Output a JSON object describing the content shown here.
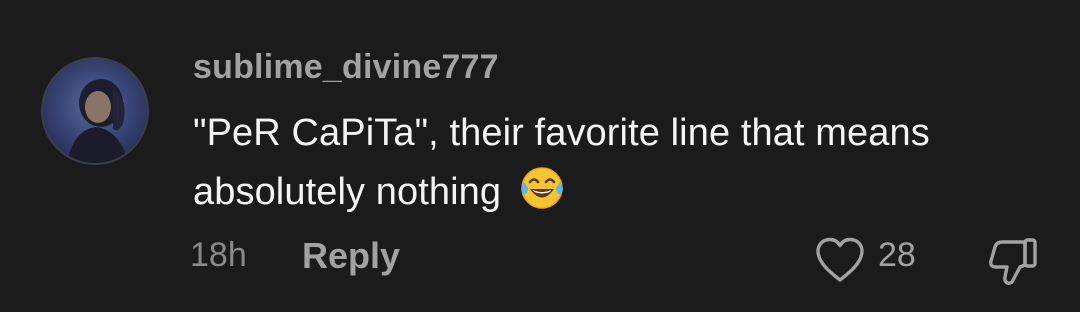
{
  "comment": {
    "username": "sublime_divine777",
    "text": "\"PeR CaPiTa\", their favorite line that means absolutely nothing",
    "emoji": "face-with-tears-of-joy",
    "time_ago": "18h",
    "reply_label": "Reply",
    "like_count": "28"
  },
  "colors": {
    "background": "#1b1b1b",
    "username": "#a2a2a2",
    "text": "#f4f4f4",
    "muted": "#8a8a8a"
  },
  "icons": {
    "like": "heart-outline-icon",
    "dislike": "thumbs-down-outline-icon"
  }
}
